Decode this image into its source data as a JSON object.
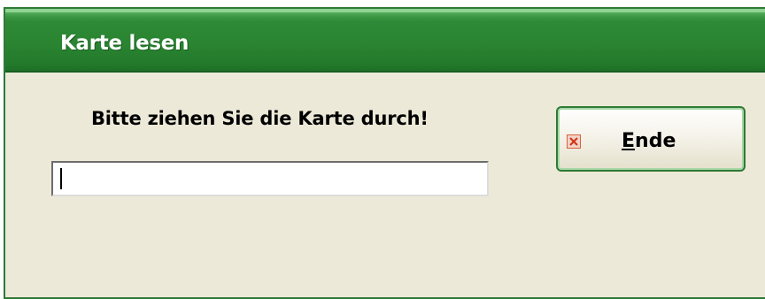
{
  "window": {
    "title": "Karte lesen"
  },
  "dialog": {
    "prompt": "Bitte ziehen Sie die Karte durch!",
    "card_input_value": "",
    "end_button": {
      "mnemonic": "E",
      "label_rest": "nde",
      "icon": "close-icon"
    }
  },
  "colors": {
    "titlebar": "#2a8431",
    "frame": "#2f7a35",
    "background": "#ece9d8"
  }
}
